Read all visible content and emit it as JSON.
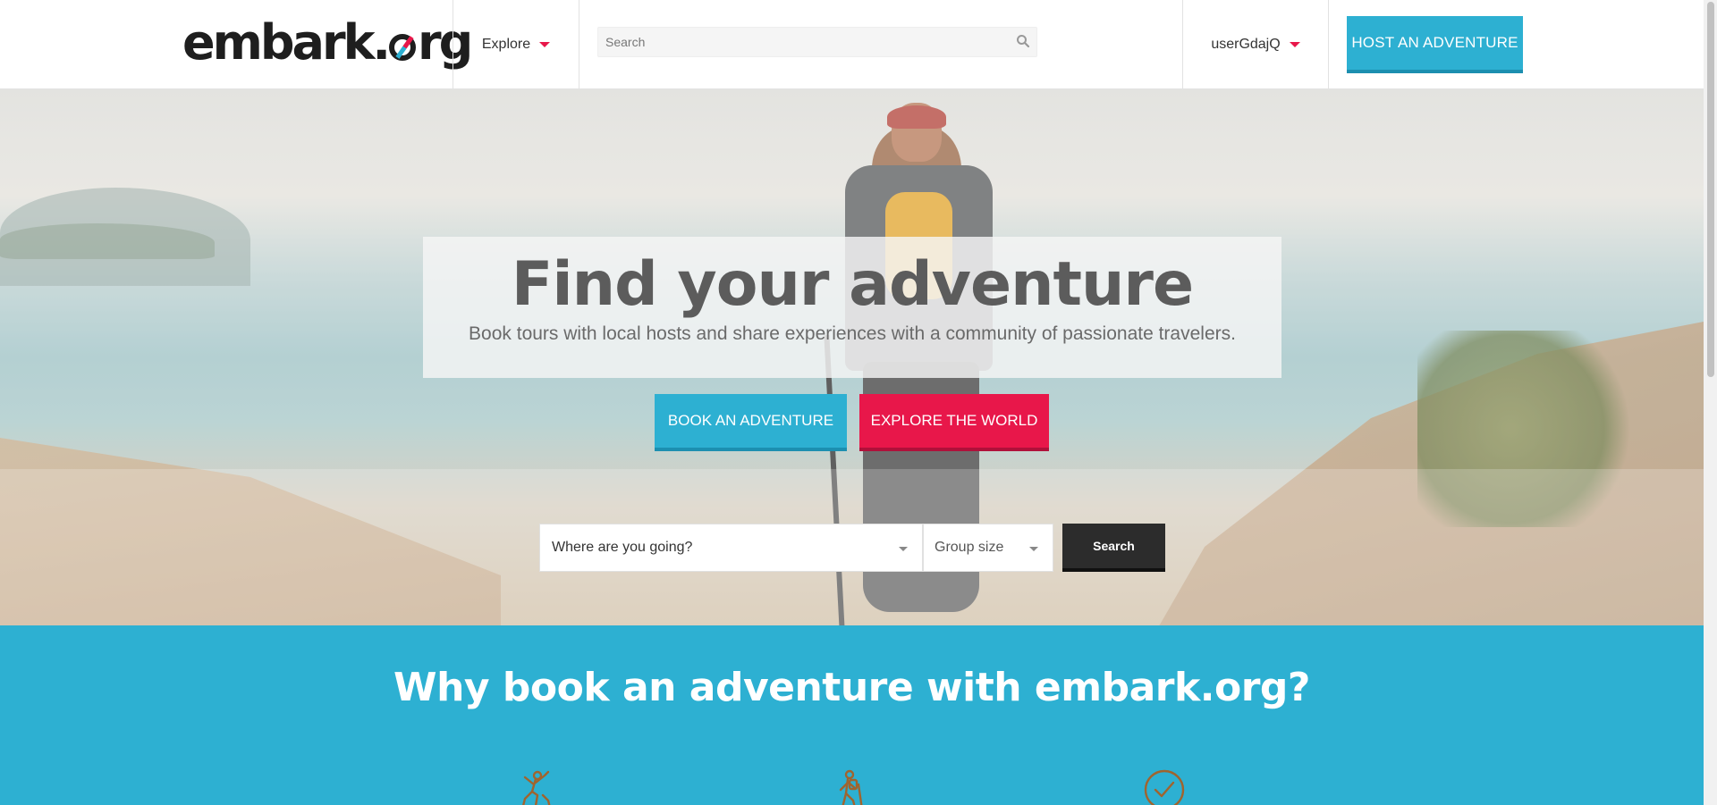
{
  "header": {
    "logo_text": "embark.org",
    "logo_part1": "embark.",
    "logo_part2": "rg",
    "explore_label": "Explore",
    "search_placeholder": "Search",
    "username": "userGdajQ",
    "host_button": "HOST AN ADVENTURE"
  },
  "hero": {
    "title": "Find your adventure",
    "subtitle": "Book tours with local hosts and share experiences with a community of passionate travelers.",
    "book_button": "BOOK AN ADVENTURE",
    "explore_button": "EXPLORE THE WORLD",
    "destination_placeholder": "Where are you going?",
    "group_size_label": "Group size",
    "search_button": "Search"
  },
  "why": {
    "title": "Why book an adventure with embark.org?",
    "icons": [
      "climber-icon",
      "hiker-icon",
      "checkmark-circle-icon"
    ]
  },
  "colors": {
    "accent_blue": "#2db0d2",
    "accent_red": "#e8174a",
    "dark": "#2c2c2c"
  }
}
